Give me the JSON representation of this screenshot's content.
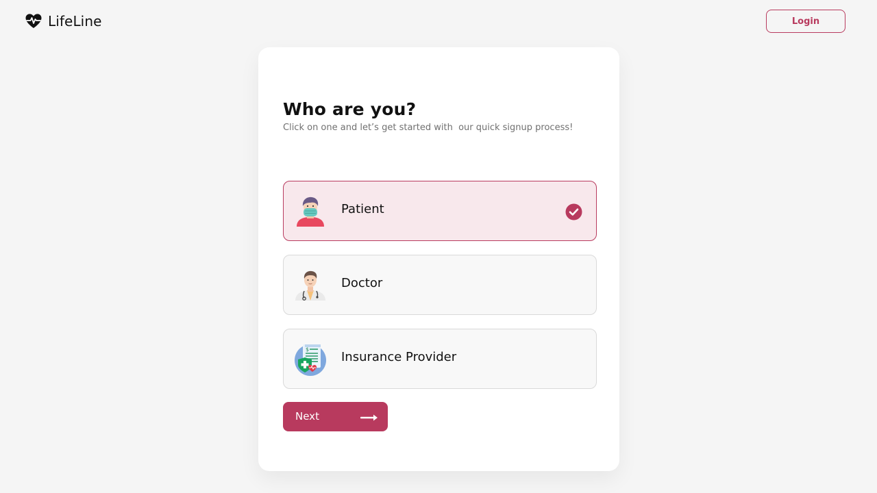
{
  "brand": {
    "name": "LifeLine",
    "icon": "heart-pulse-icon"
  },
  "header": {
    "login_label": "Login"
  },
  "signup": {
    "title": "Who are you?",
    "subtitle": "Click on one and let’s get started with  our quick signup process!",
    "options": [
      {
        "label": "Patient",
        "icon": "patient-avatar-icon",
        "selected": true
      },
      {
        "label": "Doctor",
        "icon": "doctor-avatar-icon",
        "selected": false
      },
      {
        "label": "Insurance Provider",
        "icon": "insurance-document-icon",
        "selected": false
      }
    ],
    "next_label": "Next"
  },
  "colors": {
    "accent": "#b83a5e",
    "selected_bg": "#f8e8ec",
    "page_bg": "#f5f5f5",
    "card_bg": "#ffffff"
  }
}
